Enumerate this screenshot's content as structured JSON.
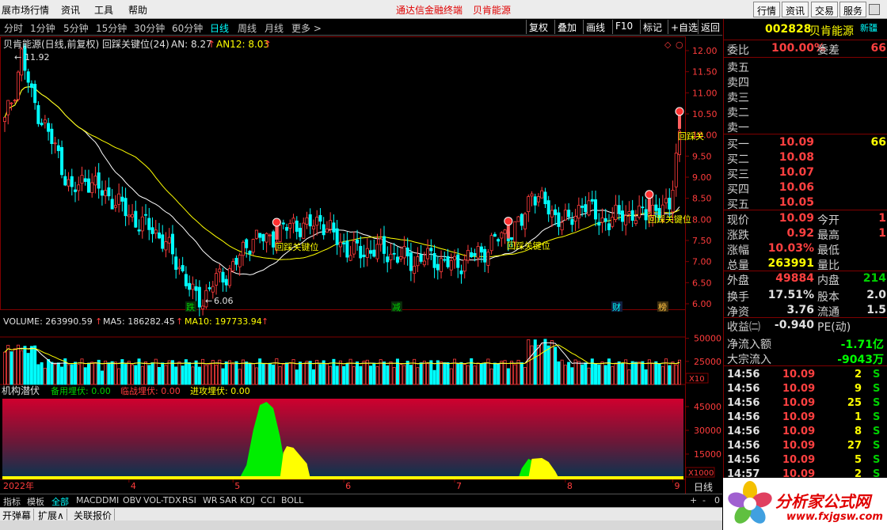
{
  "menubar": {
    "items": [
      "展市场行情",
      "资讯",
      "工具",
      "帮助"
    ],
    "center_title": "通达信金融终端",
    "center_stock": "贝肯能源",
    "right_buttons": [
      "行情",
      "资讯",
      "交易",
      "服务"
    ]
  },
  "toolbar": {
    "periods": [
      "分时",
      "1分钟",
      "5分钟",
      "15分钟",
      "30分钟",
      "60分钟",
      "日线",
      "周线",
      "月线",
      "更多 >"
    ],
    "active_period": "日线",
    "buttons": [
      "复权",
      "叠加",
      "画线",
      "F10",
      "标记",
      "+自选",
      "返回"
    ]
  },
  "main_chart": {
    "legend_name": "贝肯能源(日线,前复权) 回踩关键位(24)",
    "an_label": "AN: 8.27",
    "an_arrow": "↑",
    "an12_label": "AN12: 8.03",
    "an12_arrow": "↑",
    "high_label": "11.92",
    "low_label": "6.06",
    "signal_text": "回踩关键位",
    "signal_text_short": "回踩关",
    "markers": [
      "跌",
      "减",
      "财",
      "榜"
    ]
  },
  "volume_chart": {
    "legend_volume": "VOLUME: 263990.59",
    "legend_ma5": "MA5: 186282.45",
    "legend_ma10": "MA10: 197733.94",
    "unit": "X10"
  },
  "indicator_chart": {
    "title": "机构潜伏",
    "backup": "备用埋伏: 0.00",
    "critical": "临战埋伏: 0.00",
    "attack": "进攻埋伏: 0.00",
    "unit": "X1000"
  },
  "time_axis": {
    "year_label": "2022年",
    "month_labels": [
      "4",
      "5",
      "6",
      "7",
      "8",
      "9"
    ],
    "period_label": "日线"
  },
  "chart_data": [
    {
      "type": "candlestick",
      "title": "贝肯能源(日线,前复权)",
      "y_ticks": [
        "12.00",
        "11.50",
        "11.00",
        "10.50",
        "10.00",
        "9.50",
        "9.00",
        "8.50",
        "8.00",
        "7.50",
        "7.00",
        "6.50",
        "6.00"
      ],
      "ylim": [
        5.85,
        12.2
      ],
      "high": 11.92,
      "low": 6.06,
      "last_close": 10.09
    },
    {
      "type": "bar",
      "title": "VOLUME",
      "y_ticks": [
        "50000",
        "25000"
      ],
      "ylim": [
        0,
        60000
      ]
    },
    {
      "type": "area",
      "title": "机构潜伏",
      "y_ticks": [
        "45000",
        "30000",
        "15000"
      ],
      "ylim": [
        0,
        50000
      ]
    }
  ],
  "quote": {
    "code": "002828",
    "name": "贝肯能源",
    "badge": "新疆",
    "weibi_label": "委比",
    "weibi_value": "100.00%",
    "weicha_label": "委差",
    "weicha_value": "66",
    "sell": [
      {
        "label": "卖五"
      },
      {
        "label": "卖四"
      },
      {
        "label": "卖三"
      },
      {
        "label": "卖二"
      },
      {
        "label": "卖一"
      }
    ],
    "buy": [
      {
        "label": "买一",
        "price": "10.09",
        "vol": "66"
      },
      {
        "label": "买二",
        "price": "10.08",
        "vol": ""
      },
      {
        "label": "买三",
        "price": "10.07",
        "vol": ""
      },
      {
        "label": "买四",
        "price": "10.06",
        "vol": ""
      },
      {
        "label": "买五",
        "price": "10.05",
        "vol": ""
      }
    ],
    "stats": [
      {
        "l": "现价",
        "v": "10.09",
        "c": "#ff4040",
        "l2": "今开",
        "v2": "1",
        "c2": "#ff4040"
      },
      {
        "l": "涨跌",
        "v": "0.92",
        "c": "#ff4040",
        "l2": "最高",
        "v2": "1",
        "c2": "#ff4040"
      },
      {
        "l": "涨幅",
        "v": "10.03%",
        "c": "#ff4040",
        "l2": "最低",
        "v2": "",
        "c2": "#ff4040"
      },
      {
        "l": "总量",
        "v": "263991",
        "c": "#ffff00",
        "l2": "量比",
        "v2": "",
        "c2": "#ffff00"
      },
      {
        "l": "外盘",
        "v": "49884",
        "c": "#ff4040",
        "l2": "内盘",
        "v2": "214",
        "c2": "#00d000"
      },
      {
        "l": "换手",
        "v": "17.51%",
        "c": "#e0e0e0",
        "l2": "股本",
        "v2": "2.0",
        "c2": "#e0e0e0"
      },
      {
        "l": "净资",
        "v": "3.76",
        "c": "#e0e0e0",
        "l2": "流通",
        "v2": "1.5",
        "c2": "#e0e0e0"
      },
      {
        "l": "收益㈡",
        "v": "-0.940",
        "c": "#e0e0e0",
        "l2": "PE(动)",
        "v2": "",
        "c2": "#e0e0e0"
      }
    ],
    "flow": [
      {
        "l": "净流入额",
        "v": "-1.71亿"
      },
      {
        "l": "大宗流入",
        "v": "-9043万"
      }
    ],
    "ticks": [
      {
        "t": "14:56",
        "p": "10.09",
        "v": "2",
        "s": "S",
        "sc": "#00d000"
      },
      {
        "t": "14:56",
        "p": "10.09",
        "v": "9",
        "s": "S",
        "sc": "#00d000"
      },
      {
        "t": "14:56",
        "p": "10.09",
        "v": "25",
        "s": "S",
        "sc": "#00d000"
      },
      {
        "t": "14:56",
        "p": "10.09",
        "v": "1",
        "s": "S",
        "sc": "#00d000"
      },
      {
        "t": "14:56",
        "p": "10.09",
        "v": "8",
        "s": "S",
        "sc": "#00d000"
      },
      {
        "t": "14:56",
        "p": "10.09",
        "v": "27",
        "s": "S",
        "sc": "#00d000"
      },
      {
        "t": "14:56",
        "p": "10.09",
        "v": "5",
        "s": "S",
        "sc": "#00d000"
      },
      {
        "t": "14:57",
        "p": "10.09",
        "v": "2",
        "s": "S",
        "sc": "#00d000"
      }
    ]
  },
  "bottom_tabs": [
    "指标",
    "模板",
    "全部",
    "MACD",
    "DMI",
    "OBV",
    "VOL-TDX",
    "RSI",
    "WR",
    "SAR",
    "KDJ",
    "CCI",
    "BOLL"
  ],
  "bottom_tab_active": "全部",
  "bottom_bar": [
    "开弹幕",
    "扩展∧",
    "关联报价"
  ],
  "zoom_controls": [
    "+",
    "-",
    "0"
  ],
  "logo": {
    "text": "分析家公式网",
    "url": "www.fxjgsw.com"
  },
  "colors": {
    "up": "#ff3c3c",
    "down": "#00ffff",
    "ma_white": "#ffffff",
    "ma_yellow": "#ffff00",
    "panel_border": "#800000"
  }
}
